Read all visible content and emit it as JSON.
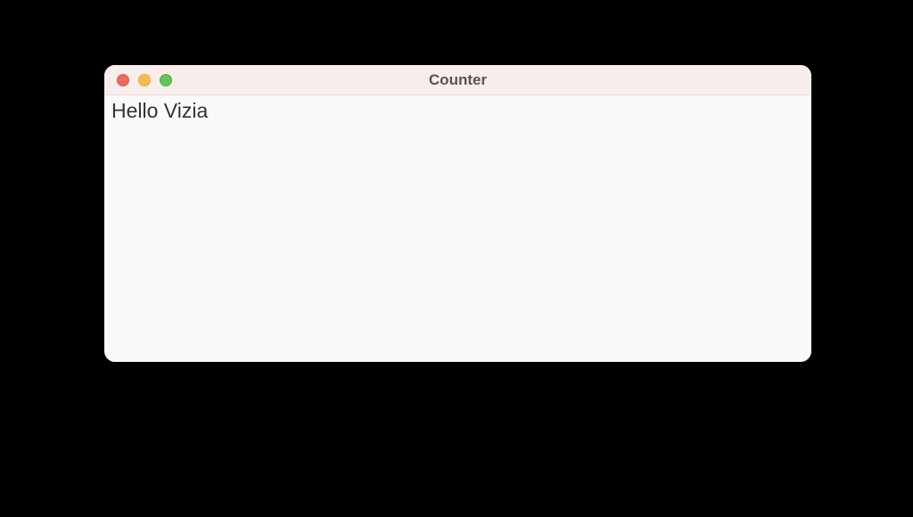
{
  "window": {
    "title": "Counter"
  },
  "content": {
    "label": "Hello Vizia"
  }
}
